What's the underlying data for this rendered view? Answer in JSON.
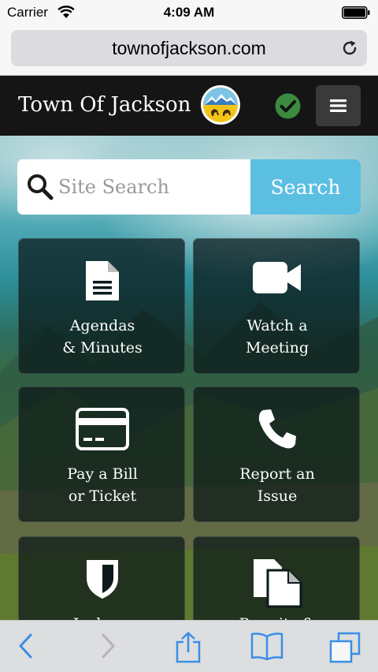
{
  "status_bar": {
    "carrier": "Carrier",
    "time": "4:09 AM"
  },
  "browser": {
    "url": "townofjackson.com"
  },
  "header": {
    "title": "Town Of Jackson",
    "icons": [
      "town-seal-icon",
      "checkmark-badge-icon",
      "hamburger-menu-icon"
    ]
  },
  "search": {
    "placeholder": "Site Search",
    "button_label": "Search"
  },
  "tiles": [
    {
      "label": "Agendas\n& Minutes",
      "icon": "document-icon"
    },
    {
      "label": "Watch a\nMeeting",
      "icon": "video-camera-icon"
    },
    {
      "label": "Pay a Bill\nor Ticket",
      "icon": "credit-card-icon"
    },
    {
      "label": "Report an\nIssue",
      "icon": "phone-icon"
    },
    {
      "label": "Jackson\nPolice",
      "icon": "shield-icon"
    },
    {
      "label": "Permits &\nLicenses",
      "icon": "documents-icon"
    }
  ],
  "colors": {
    "header_bg": "#151515",
    "search_button": "#5bbfe2",
    "toolbar_tint": "#3a8ee6",
    "check_badge": "#3c8a3f"
  }
}
